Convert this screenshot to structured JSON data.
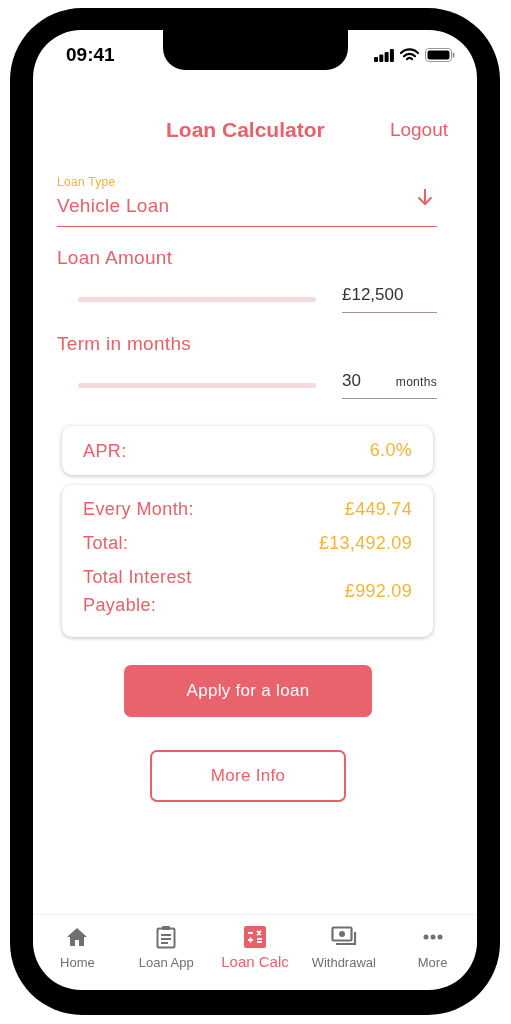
{
  "status_bar": {
    "time": "09:41"
  },
  "header": {
    "title": "Loan Calculator",
    "action": "Logout"
  },
  "loan_type": {
    "label": "Loan Type",
    "value": "Vehicle Loan"
  },
  "sliders": [
    {
      "label": "Loan Amount",
      "value": "£12,500"
    },
    {
      "label": "Term in months",
      "value": "30",
      "unit": "months"
    }
  ],
  "apr": {
    "label": "APR:",
    "value": "6.0%"
  },
  "results": [
    {
      "label": "Every Month:",
      "value": "£449.74"
    },
    {
      "label": "Total:",
      "value": "£13,492.09"
    },
    {
      "label": "Total Interest Payable:",
      "value": "£992.09"
    }
  ],
  "buttons": [
    {
      "label": "Apply for a loan",
      "kind": "filled"
    },
    {
      "label": "More Info",
      "kind": "outlined"
    }
  ],
  "nav": [
    {
      "label": "Home",
      "kind": "home",
      "selected": false
    },
    {
      "label": "Loan App",
      "kind": "clipboard",
      "selected": false
    },
    {
      "label": "Loan Calc",
      "kind": "calculator",
      "selected": true
    },
    {
      "label": "Withdrawal",
      "kind": "money",
      "selected": false
    },
    {
      "label": "More",
      "kind": "more",
      "selected": false
    }
  ]
}
